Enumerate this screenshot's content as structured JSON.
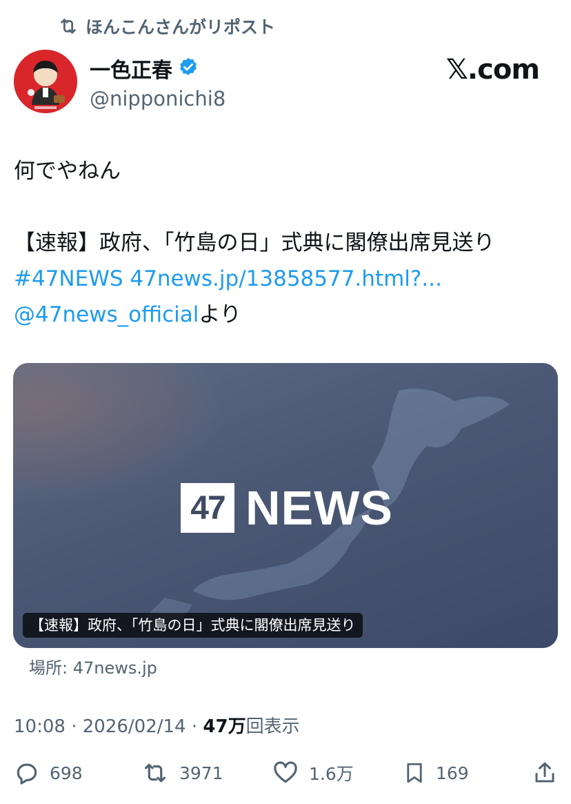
{
  "repost_banner": {
    "icon": "repost-icon",
    "text": "ほんこんさんがリポスト"
  },
  "author": {
    "display_name": "一色正春",
    "verified": true,
    "handle": "@nipponichi8",
    "avatar_bg": "#d8262b"
  },
  "brand": "𝕏.com",
  "tweet": {
    "line1": "何でやねん",
    "line2": "【速報】政府、「竹島の日」式典に閣僚出席見送り",
    "hashtag": "#47NEWS",
    "url": "47news.jp/13858577.html?...",
    "mention": "@47news_official",
    "mention_suffix": "より"
  },
  "card": {
    "logo_box": "47",
    "logo_word": "NEWS",
    "caption": "【速報】政府、「竹島の日」式典に閣僚出席見送り",
    "domain": "場所: 47news.jp"
  },
  "meta": {
    "time": "10:08",
    "date": "2026/02/14",
    "views": "47万",
    "views_label": "回表示"
  },
  "actions": {
    "replies": "698",
    "reposts": "3971",
    "likes": "1.6万",
    "bookmarks": "169"
  },
  "colors": {
    "link": "#1d9bf0",
    "secondary_text": "#536471",
    "primary_text": "#0f1419",
    "verified_badge": "#1d9bf0"
  }
}
